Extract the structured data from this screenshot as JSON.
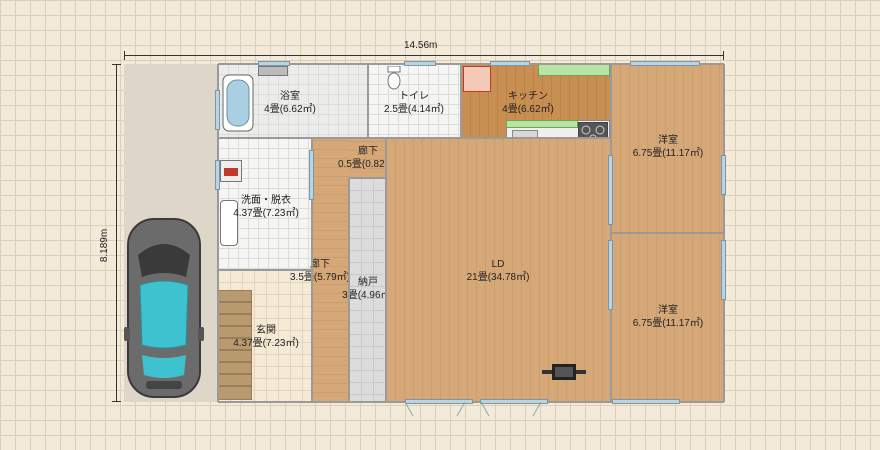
{
  "dimensions": {
    "width": "14.56m",
    "depth": "8.189m"
  },
  "rooms": {
    "bath": {
      "name": "浴室",
      "area": "4畳(6.62㎡)"
    },
    "toilet": {
      "name": "トイレ",
      "area": "2.5畳(4.14㎡)"
    },
    "kitchen": {
      "name": "キッチン",
      "area": "4畳(6.62㎡)"
    },
    "west_room_top": {
      "name": "洋室",
      "area": "6.75畳(11.17㎡)"
    },
    "corridor_small": {
      "name": "廊下",
      "area": "0.5畳(0.82㎡)"
    },
    "washroom": {
      "name": "洗面・脱衣",
      "area": "4.37畳(7.23㎡)"
    },
    "corridor": {
      "name": "廊下",
      "area": "3.5畳(5.79㎡)"
    },
    "storage": {
      "name": "納戸",
      "area": "3畳(4.96㎡)"
    },
    "ld": {
      "name": "LD",
      "area": "21畳(34.78㎡)"
    },
    "west_room_bottom": {
      "name": "洋室",
      "area": "6.75畳(11.17㎡)"
    },
    "entrance": {
      "name": "玄関",
      "area": "4.37畳(7.23㎡)"
    }
  },
  "colors": {
    "floor_wood": "#d6a878",
    "kitchen_wood": "#c98f52",
    "car_teal": "#3fc2cf",
    "car_body": "#6b6b6b"
  }
}
